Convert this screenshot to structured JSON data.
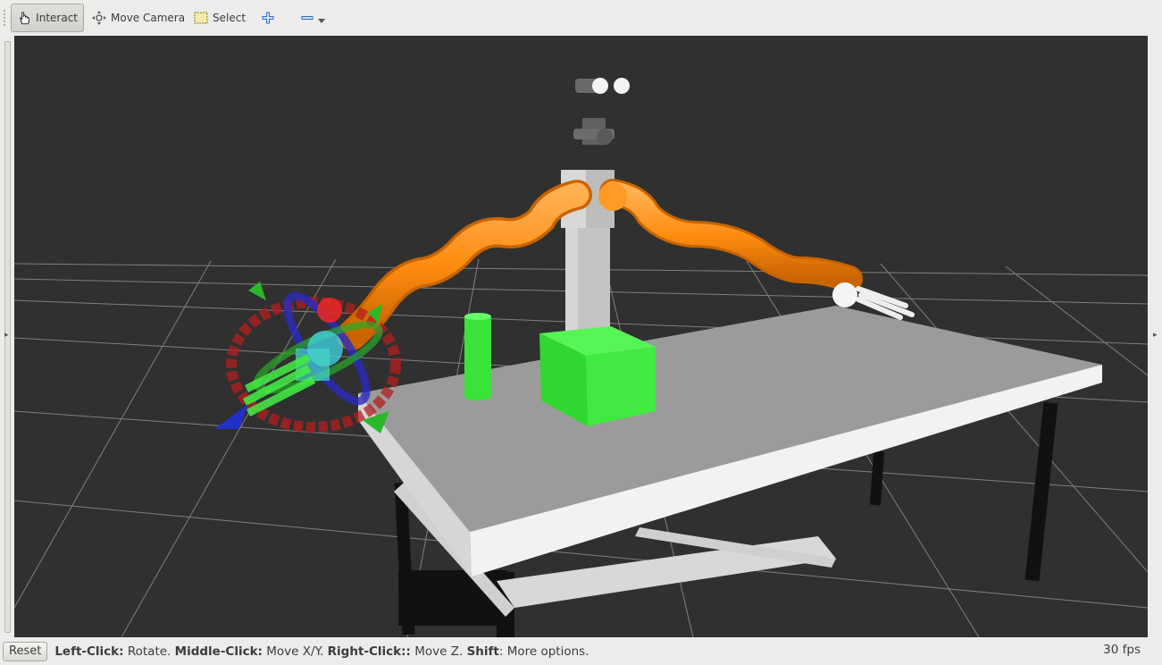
{
  "toolbar": {
    "tools": [
      {
        "label": "Interact",
        "icon": "hand-pointer-icon",
        "active": true
      },
      {
        "label": "Move Camera",
        "icon": "move-camera-icon",
        "active": false
      },
      {
        "label": "Select",
        "icon": "select-rectangle-icon",
        "active": false
      }
    ],
    "add_tool_icon": "plus-icon",
    "remove_tool_icon": "minus-icon"
  },
  "status": {
    "reset_label": "Reset",
    "hint": [
      {
        "key": "Left-Click:",
        "text": " Rotate. "
      },
      {
        "key": "Middle-Click:",
        "text": " Move X/Y. "
      },
      {
        "key": "Right-Click::",
        "text": " Move Z. "
      },
      {
        "key": "Shift",
        "text": ": More options."
      }
    ],
    "fps": "30 fps"
  },
  "colors": {
    "background": "#303030",
    "grid": "#a0a0a0",
    "arm": "#ff8c10",
    "objects": "#33e633",
    "table_top": "#9b9b9b",
    "table_edge": "#f2f2f2",
    "marker_rotate_x": "#c81e1e",
    "marker_rotate_z": "#2828c8",
    "marker_rotate_y": "#28b428"
  }
}
